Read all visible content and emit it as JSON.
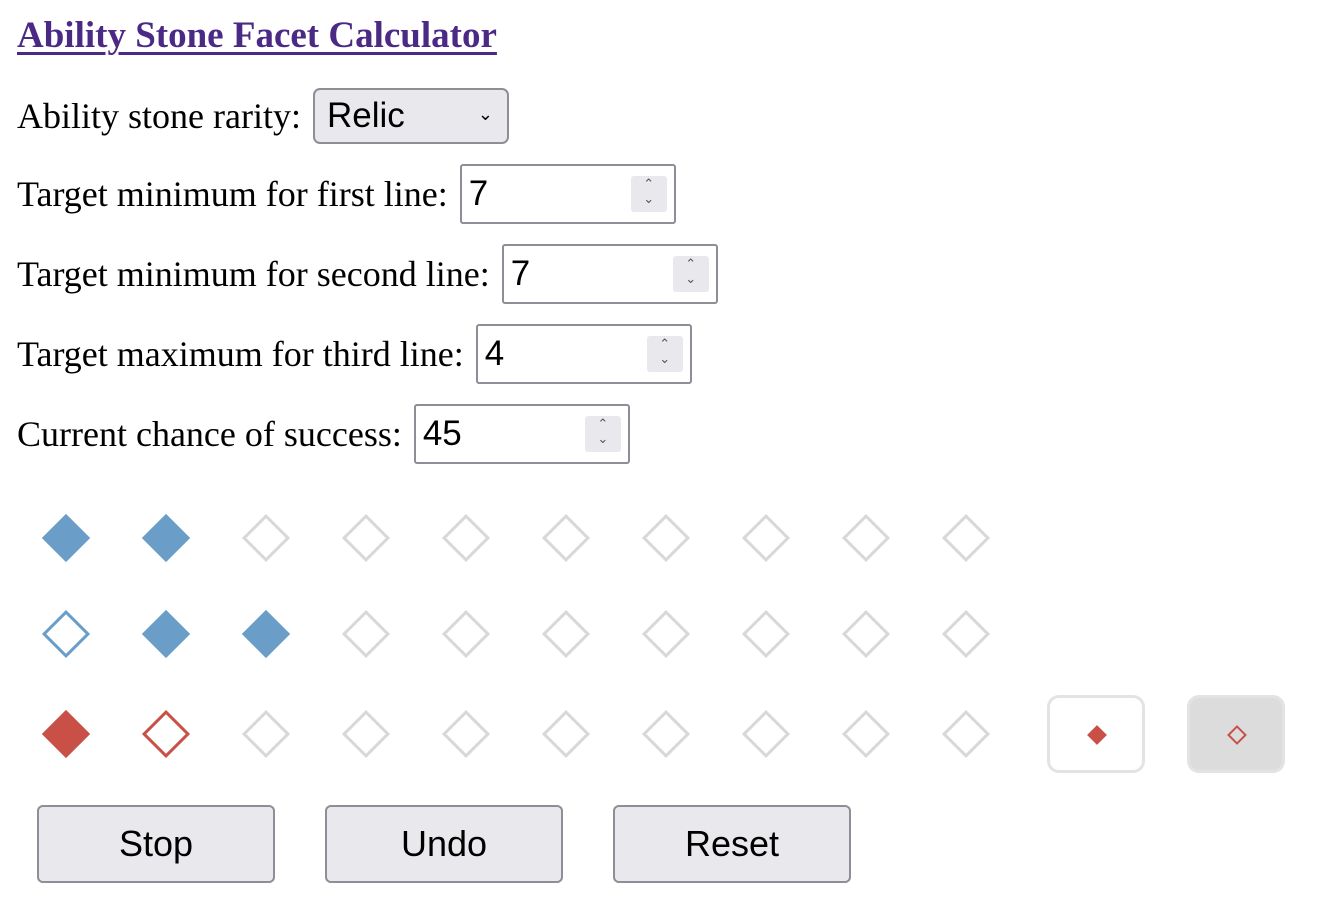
{
  "title": "Ability Stone Facet Calculator",
  "colors": {
    "blue": "#6a9ec8",
    "red": "#c85046",
    "empty": "#d8d8d8",
    "title": "#4b2a86"
  },
  "form": {
    "rarity": {
      "label": "Ability stone rarity:",
      "value": "Relic"
    },
    "first": {
      "label": "Target minimum for first line:",
      "value": "7"
    },
    "second": {
      "label": "Target minimum for second line:",
      "value": "7"
    },
    "third": {
      "label": "Target maximum for third line:",
      "value": "4"
    },
    "chance": {
      "label": "Current chance of success:",
      "value": "45"
    }
  },
  "lines": [
    {
      "color": "blue",
      "slots": [
        "success",
        "success",
        "empty",
        "empty",
        "empty",
        "empty",
        "empty",
        "empty",
        "empty",
        "empty"
      ]
    },
    {
      "color": "blue",
      "slots": [
        "fail",
        "success",
        "success",
        "empty",
        "empty",
        "empty",
        "empty",
        "empty",
        "empty",
        "empty"
      ]
    },
    {
      "color": "red",
      "slots": [
        "success",
        "fail",
        "empty",
        "empty",
        "empty",
        "empty",
        "empty",
        "empty",
        "empty",
        "empty"
      ]
    }
  ],
  "third_line_selector": {
    "options": [
      "success",
      "fail"
    ],
    "selected": "fail"
  },
  "buttons": {
    "stop": "Stop",
    "undo": "Undo",
    "reset": "Reset"
  }
}
